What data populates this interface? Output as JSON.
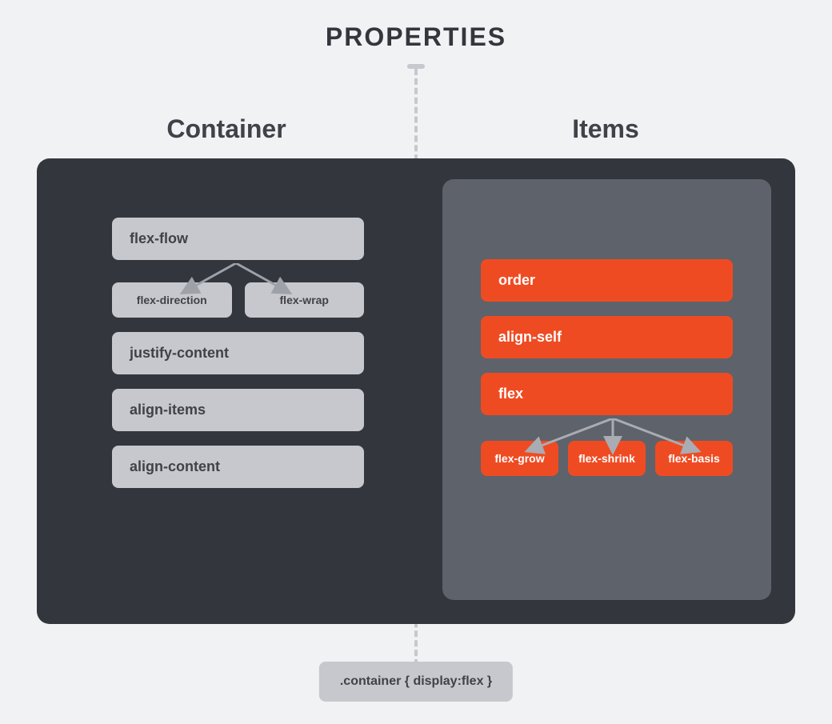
{
  "title": "PROPERTIES",
  "columns": {
    "left": "Container",
    "right": "Items"
  },
  "container": {
    "flex_flow": "flex-flow",
    "flex_direction": "flex-direction",
    "flex_wrap": "flex-wrap",
    "justify_content": "justify-content",
    "align_items": "align-items",
    "align_content": "align-content"
  },
  "items": {
    "order": "order",
    "align_self": "align-self",
    "flex": "flex",
    "flex_grow": "flex-grow",
    "flex_shrink": "flex-shrink",
    "flex_basis": "flex-basis"
  },
  "caption": ".container { display:flex }",
  "colors": {
    "bg": "#f1f2f3",
    "panel": "#33363d",
    "inner": "#5e626a",
    "grey_chip": "#c6c8cd",
    "orange_chip": "#ef4b23"
  }
}
